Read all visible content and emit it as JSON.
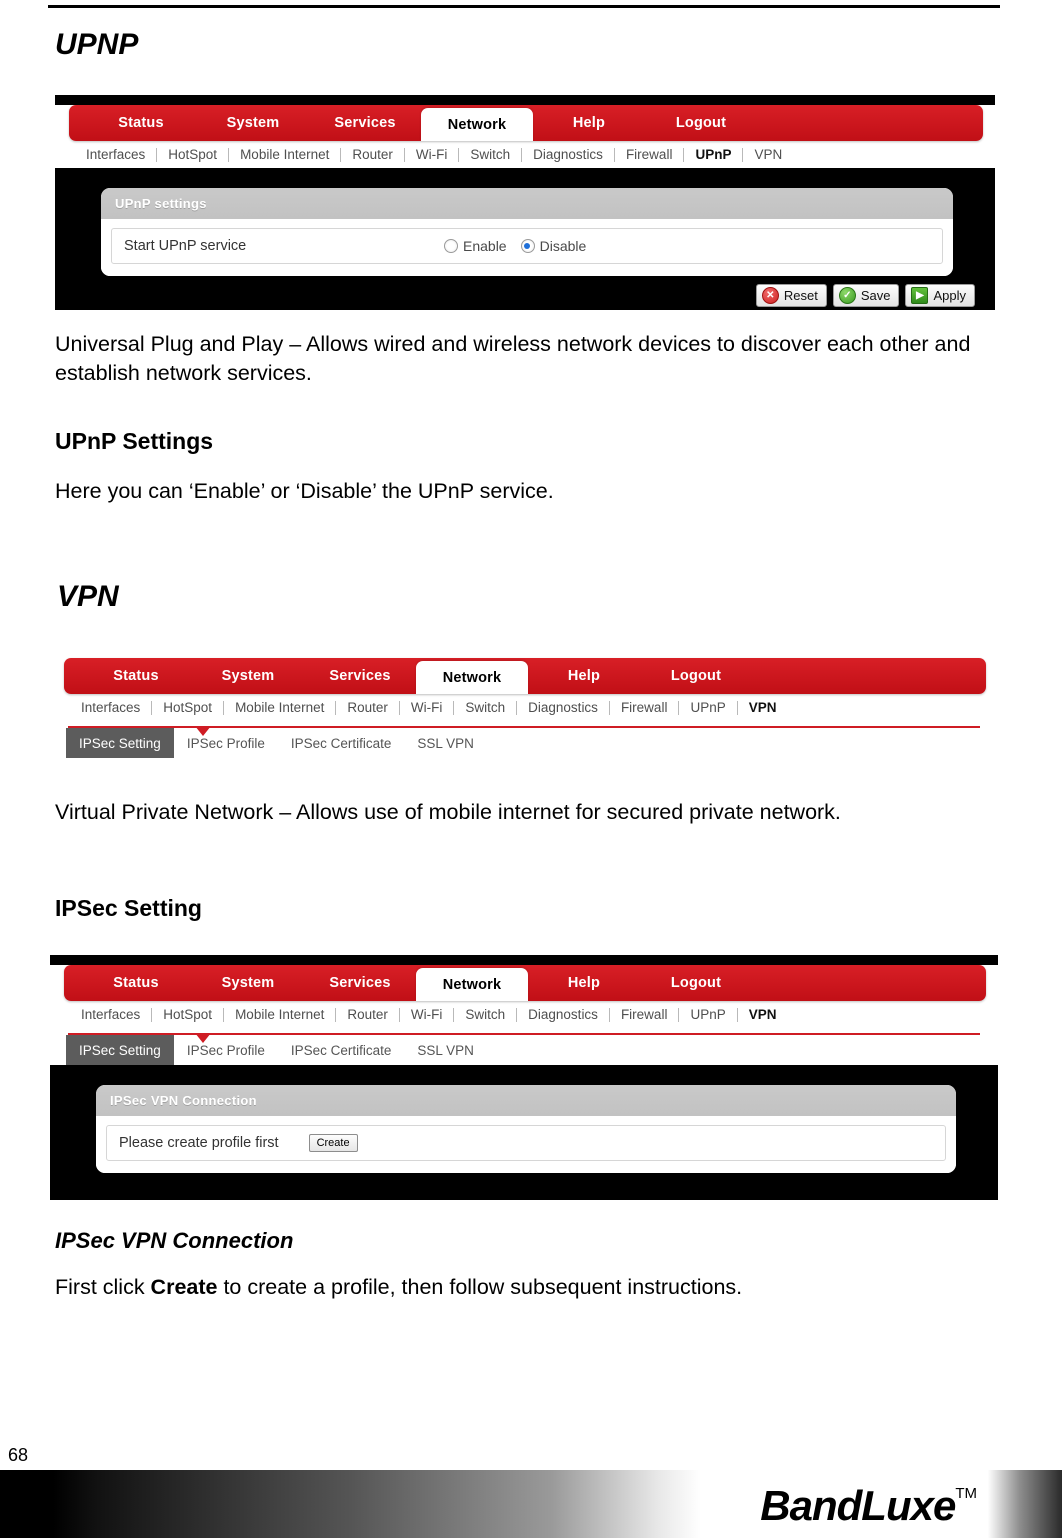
{
  "page": {
    "number": "68",
    "brand": "BandLuxe",
    "brand_tm": "TM"
  },
  "sections": {
    "upnp": {
      "title": "UPNP",
      "description": "Universal Plug and Play – Allows wired and wireless network devices to discover each other and establish network services.",
      "subheading": "UPnP Settings",
      "subtext": "Here you can ‘Enable’ or ‘Disable’ the UPnP service."
    },
    "vpn": {
      "title": "VPN",
      "description": "Virtual Private Network – Allows use of mobile internet for secured private network.",
      "subheading": "IPSec Setting",
      "conn_heading": "IPSec VPN Connection",
      "conn_text_pre": "First click ",
      "conn_text_bold": "Create",
      "conn_text_post": " to create a profile, then follow subsequent instructions."
    }
  },
  "router_ui": {
    "main_tabs": [
      {
        "label": "Status",
        "active": false
      },
      {
        "label": "System",
        "active": false
      },
      {
        "label": "Services",
        "active": false
      },
      {
        "label": "Network",
        "active": true
      },
      {
        "label": "Help",
        "active": false
      },
      {
        "label": "Logout",
        "active": false
      }
    ],
    "sub_nav_upnp": [
      {
        "label": "Interfaces",
        "active": false
      },
      {
        "label": "HotSpot",
        "active": false
      },
      {
        "label": "Mobile Internet",
        "active": false
      },
      {
        "label": "Router",
        "active": false
      },
      {
        "label": "Wi-Fi",
        "active": false
      },
      {
        "label": "Switch",
        "active": false
      },
      {
        "label": "Diagnostics",
        "active": false
      },
      {
        "label": "Firewall",
        "active": false
      },
      {
        "label": "UPnP",
        "active": true
      },
      {
        "label": "VPN",
        "active": false
      }
    ],
    "sub_nav_vpn": [
      {
        "label": "Interfaces",
        "active": false
      },
      {
        "label": "HotSpot",
        "active": false
      },
      {
        "label": "Mobile Internet",
        "active": false
      },
      {
        "label": "Router",
        "active": false
      },
      {
        "label": "Wi-Fi",
        "active": false
      },
      {
        "label": "Switch",
        "active": false
      },
      {
        "label": "Diagnostics",
        "active": false
      },
      {
        "label": "Firewall",
        "active": false
      },
      {
        "label": "UPnP",
        "active": false
      },
      {
        "label": "VPN",
        "active": true
      }
    ],
    "vpn_sub_tabs": [
      {
        "label": "IPSec Setting",
        "active": true
      },
      {
        "label": "IPSec Profile",
        "active": false
      },
      {
        "label": "IPSec Certificate",
        "active": false
      },
      {
        "label": "SSL VPN",
        "active": false
      }
    ],
    "upnp_panel": {
      "header": "UPnP settings",
      "row_label": "Start UPnP service",
      "radio_enable": "Enable",
      "radio_disable": "Disable",
      "selected": "Disable"
    },
    "ipsec_panel": {
      "header": "IPSec VPN Connection",
      "row_label": "Please create profile first",
      "create_button": "Create"
    },
    "action_buttons": [
      {
        "label": "Reset",
        "icon": "reset-icon"
      },
      {
        "label": "Save",
        "icon": "save-icon"
      },
      {
        "label": "Apply",
        "icon": "apply-icon"
      }
    ],
    "colors": {
      "brand_red": "#cf1c24",
      "panel_gray": "#c5c5c5",
      "active_tab_gray": "#5c5c5c",
      "radio_blue": "#1e6fd9"
    }
  }
}
